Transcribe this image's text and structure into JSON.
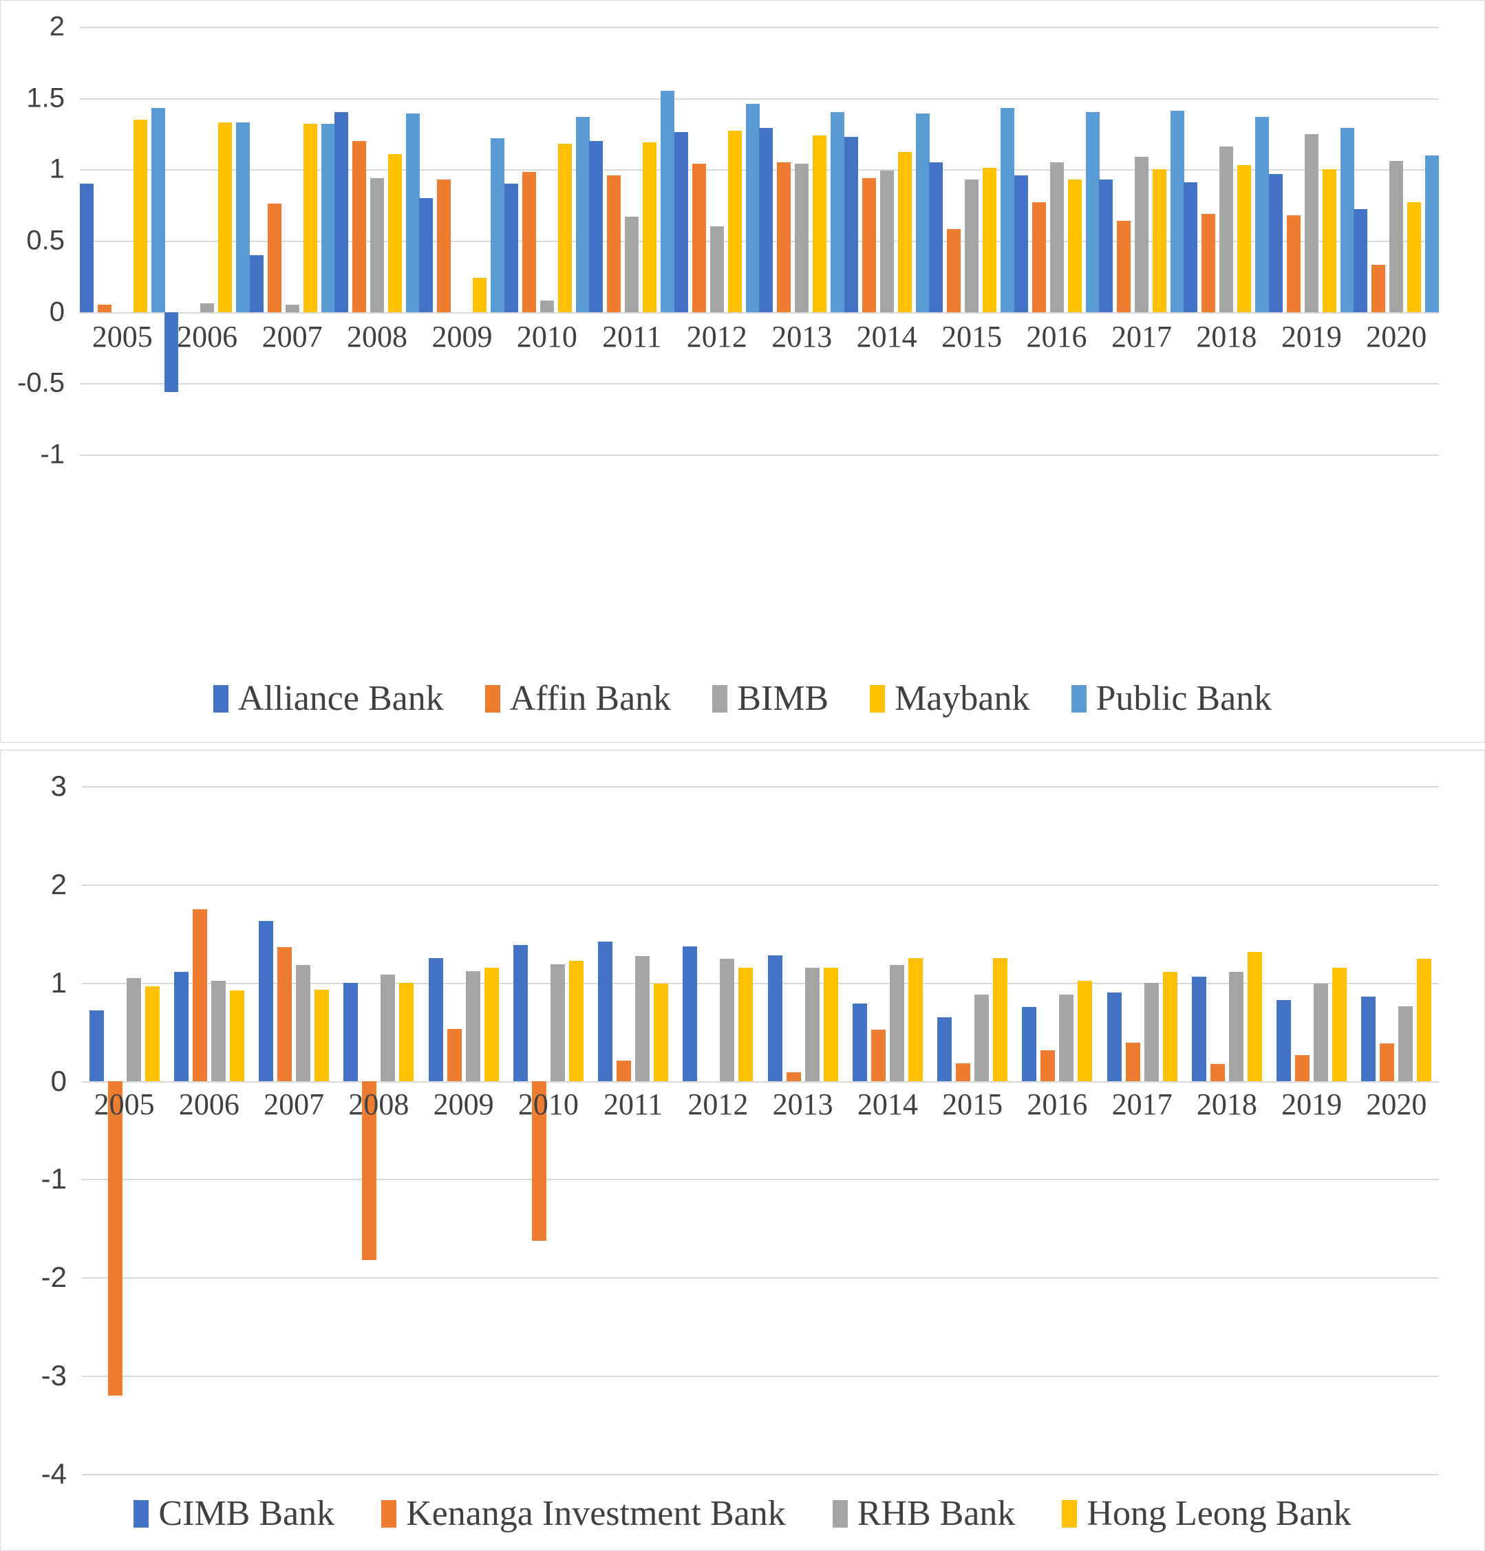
{
  "chart_data": [
    {
      "type": "bar",
      "title": "",
      "xlabel": "",
      "ylabel": "",
      "ylim": [
        -1,
        2
      ],
      "yticks": [
        2,
        1.5,
        1,
        0.5,
        0,
        -0.5,
        -1
      ],
      "ytick_labels": [
        "2",
        "1.5",
        "1",
        "0.5",
        "0",
        "-0.5",
        "-1"
      ],
      "grid": true,
      "legend_position": "bottom",
      "categories": [
        "2005",
        "2006",
        "2007",
        "2008",
        "2009",
        "2010",
        "2011",
        "2012",
        "2013",
        "2014",
        "2015",
        "2016",
        "2017",
        "2018",
        "2019",
        "2020"
      ],
      "series": [
        {
          "name": "Alliance Bank",
          "color": "#4472C4",
          "values": [
            0.9,
            -0.56,
            0.4,
            1.4,
            0.8,
            0.9,
            1.2,
            1.26,
            1.29,
            1.23,
            1.05,
            0.96,
            0.93,
            0.91,
            0.97,
            0.72
          ]
        },
        {
          "name": "Affin Bank",
          "color": "#ED7D31",
          "values": [
            0.05,
            null,
            0.76,
            1.2,
            0.93,
            0.98,
            0.96,
            1.04,
            1.05,
            0.94,
            0.58,
            0.77,
            0.64,
            0.69,
            0.68,
            0.33
          ]
        },
        {
          "name": "BIMB",
          "color": "#A5A5A5",
          "values": [
            null,
            0.06,
            0.05,
            0.94,
            null,
            0.08,
            0.67,
            0.6,
            1.04,
            0.99,
            0.93,
            1.05,
            1.09,
            1.16,
            1.25,
            1.06
          ]
        },
        {
          "name": "Maybank",
          "color": "#FFC000",
          "values": [
            1.35,
            1.33,
            1.32,
            1.11,
            0.24,
            1.18,
            1.19,
            1.27,
            1.24,
            1.12,
            1.01,
            0.93,
            1.0,
            1.03,
            1.0,
            0.77
          ]
        },
        {
          "name": "Public Bank",
          "color": "#5B9BD5",
          "values": [
            1.43,
            1.33,
            1.32,
            1.39,
            1.22,
            1.37,
            1.55,
            1.46,
            1.4,
            1.39,
            1.43,
            1.4,
            1.41,
            1.37,
            1.29,
            1.1
          ]
        }
      ]
    },
    {
      "type": "bar",
      "title": "",
      "xlabel": "",
      "ylabel": "",
      "ylim": [
        -4,
        3
      ],
      "yticks": [
        3,
        2,
        1,
        0,
        -1,
        -2,
        -3,
        -4
      ],
      "ytick_labels": [
        "3",
        "2",
        "1",
        "0",
        "-1",
        "-2",
        "-3",
        "-4"
      ],
      "grid": true,
      "legend_position": "bottom",
      "categories": [
        "2005",
        "2006",
        "2007",
        "2008",
        "2009",
        "2010",
        "2011",
        "2012",
        "2013",
        "2014",
        "2015",
        "2016",
        "2017",
        "2018",
        "2019",
        "2020"
      ],
      "series": [
        {
          "name": "CIMB Bank",
          "color": "#4472C4",
          "values": [
            0.72,
            1.11,
            1.63,
            1.0,
            1.25,
            1.38,
            1.42,
            1.37,
            1.28,
            0.79,
            0.65,
            0.75,
            0.9,
            1.06,
            0.82,
            0.86
          ]
        },
        {
          "name": "Kenanga Investment Bank",
          "color": "#ED7D31",
          "values": [
            -3.2,
            1.75,
            1.36,
            -1.82,
            0.53,
            -1.63,
            0.21,
            null,
            0.09,
            0.52,
            0.18,
            0.31,
            0.39,
            0.17,
            0.26,
            0.38
          ]
        },
        {
          "name": "RHB Bank",
          "color": "#A5A5A5",
          "values": [
            1.05,
            1.02,
            1.18,
            1.08,
            1.12,
            1.19,
            1.27,
            1.24,
            1.15,
            1.18,
            0.88,
            0.88,
            1.0,
            1.11,
            0.99,
            0.76
          ]
        },
        {
          "name": "Hong Leong Bank",
          "color": "#FFC000",
          "values": [
            0.96,
            0.92,
            0.93,
            1.0,
            1.15,
            1.22,
            0.99,
            1.15,
            1.15,
            1.25,
            1.25,
            1.02,
            1.11,
            1.31,
            1.15,
            1.24
          ]
        }
      ]
    }
  ]
}
